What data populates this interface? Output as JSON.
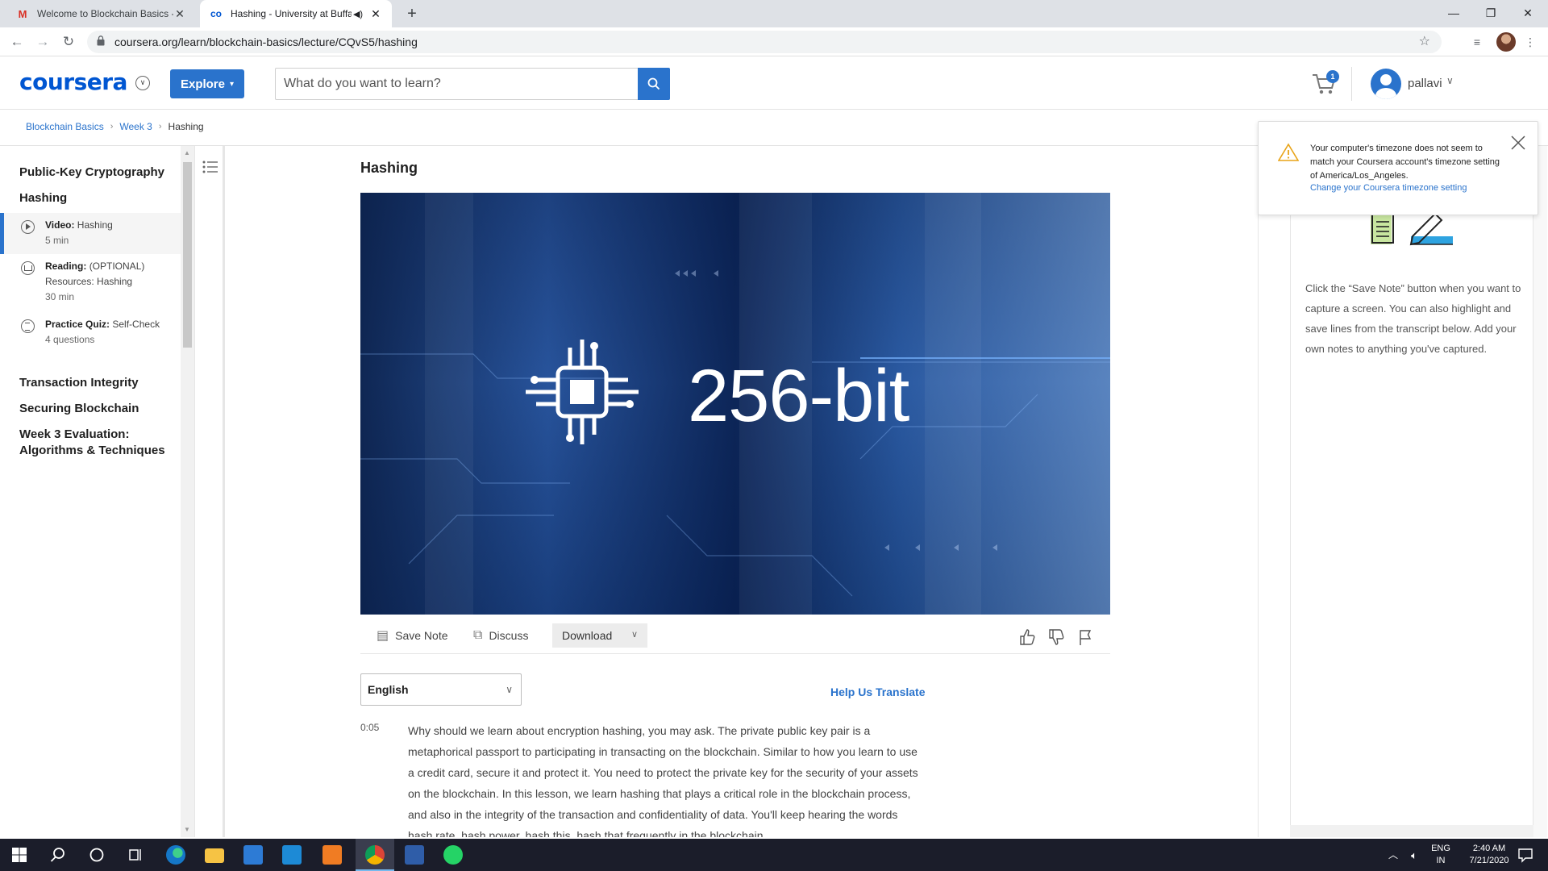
{
  "browser": {
    "tabs": [
      {
        "title": "Welcome to Blockchain Basics - B",
        "favicon": "gmail-icon",
        "active": false
      },
      {
        "title": "Hashing - University at Buffa",
        "favicon": "coursera-icon",
        "active": true
      }
    ],
    "url": "coursera.org/learn/blockchain-basics/lecture/CQvS5/hashing"
  },
  "header": {
    "logo": "coursera",
    "explore_label": "Explore",
    "search_placeholder": "What do you want to learn?",
    "cart_count": "1",
    "username": "pallavi",
    "accent": "#2a73cc"
  },
  "breadcrumb": {
    "course": "Blockchain Basics",
    "week": "Week 3",
    "current": "Hashing"
  },
  "sidebar": {
    "sections": [
      {
        "title": "Public-Key Cryptography"
      },
      {
        "title": "Hashing"
      },
      {
        "title": "Transaction Integrity"
      },
      {
        "title": "Securing Blockchain"
      },
      {
        "title": "Week 3 Evaluation: Algorithms & Techniques"
      }
    ],
    "items": [
      {
        "type": "Video:",
        "name": "Hashing",
        "meta": "5 min",
        "icon": "play-icon",
        "active": true
      },
      {
        "type": "Reading:",
        "name": "(OPTIONAL) Resources: Hashing",
        "meta": "30 min",
        "icon": "reading-icon",
        "active": false
      },
      {
        "type": "Practice Quiz:",
        "name": "Self-Check",
        "meta": "4 questions",
        "icon": "quiz-icon",
        "active": false
      }
    ]
  },
  "lecture": {
    "title": "Hashing",
    "video_text": "256-bit",
    "toolbar": {
      "save_note": "Save Note",
      "discuss": "Discuss",
      "download": "Download"
    },
    "language": "English",
    "help_translate": "Help Us Translate",
    "transcript": {
      "timestamp": "0:05",
      "text": "Why should we learn about encryption hashing, you may ask. The private public key pair is a metaphorical passport to participating in transacting on the blockchain. Similar to how you learn to use a credit card, secure it and protect it. You need to protect the private key for the security of your assets on the blockchain. In this lesson, we learn hashing that plays a critical role in the blockchain process, and also in the integrity of the transaction and confidentiality of data. You'll keep hearing the words hash rate, hash power, hash this, hash that frequently in the blockchain"
    }
  },
  "timezone_notice": {
    "message": "Your computer's timezone does not seem to match your Coursera account's timezone setting of America/Los_Angeles.",
    "link": "Change your Coursera timezone setting"
  },
  "notes": {
    "text": "Click the “Save Note” button when you want to capture a screen. You can also highlight and save lines from the transcript below. Add your own notes to anything you've captured."
  },
  "taskbar": {
    "language": "ENG",
    "region": "IN",
    "time": "2:40 AM",
    "date": "7/21/2020"
  }
}
